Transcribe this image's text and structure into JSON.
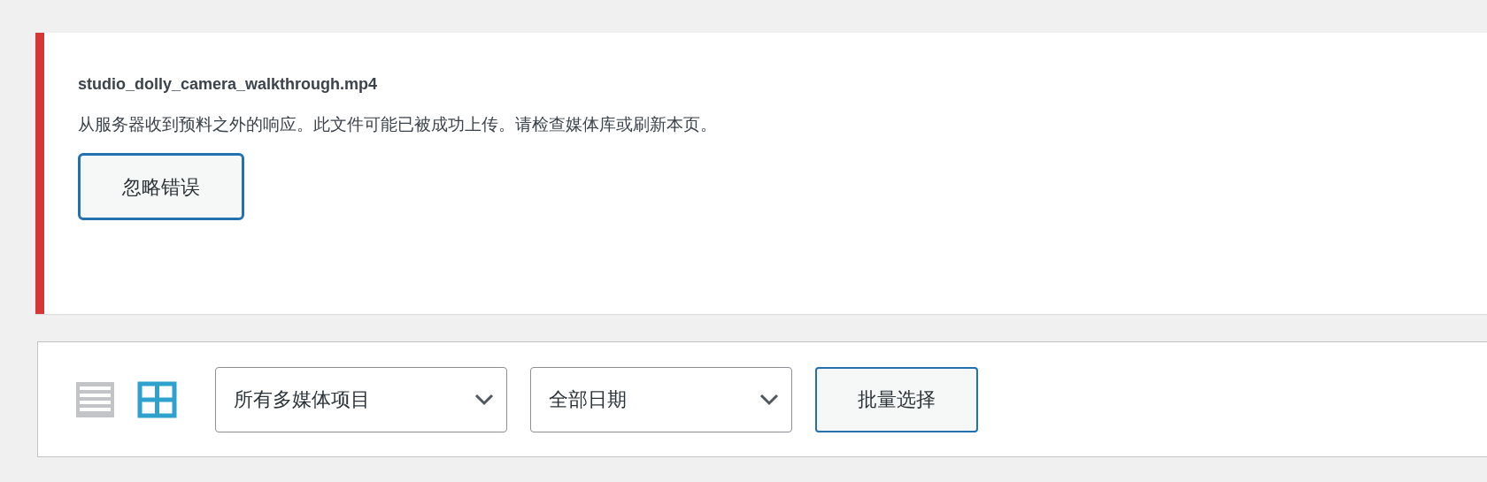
{
  "notice": {
    "filename": "studio_dolly_camera_walkthrough.mp4",
    "message": "从服务器收到预料之外的响应。此文件可能已被成功上传。请检查媒体库或刷新本页。",
    "button": "忽略错误"
  },
  "toolbar": {
    "view_modes": [
      {
        "kind": "list",
        "selected": false
      },
      {
        "kind": "grid",
        "selected": true
      }
    ],
    "filters": [
      {
        "value": "所有多媒体项目"
      },
      {
        "value": "全部日期"
      }
    ],
    "bulk_button": "批量选择"
  }
}
